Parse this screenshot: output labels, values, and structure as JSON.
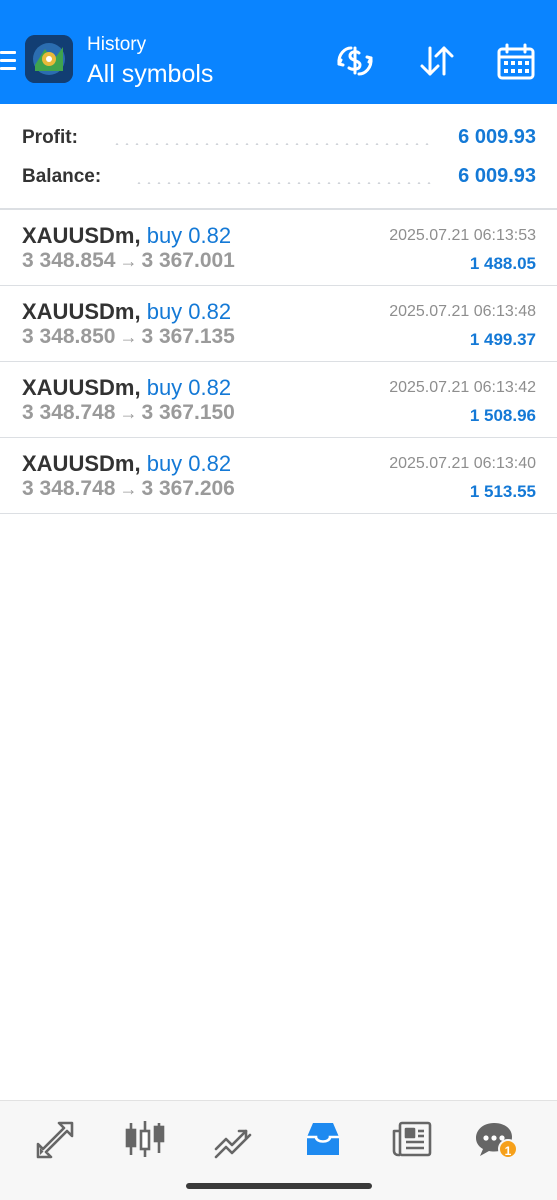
{
  "header": {
    "subtitle": "History",
    "title": "All symbols",
    "icons": [
      "menu-icon",
      "app-logo",
      "currency-filter-icon",
      "sort-icon",
      "calendar-icon"
    ],
    "accent_color": "#0a84ff"
  },
  "summary": {
    "profit_label": "Profit:",
    "profit_value": "6 009.93",
    "balance_label": "Balance:",
    "balance_value": "6 009.93"
  },
  "deals": [
    {
      "symbol": "XAUUSDm,",
      "type": "buy 0.82",
      "open_price": "3 348.854",
      "close_price": "3 367.001",
      "time": "2025.07.21 06:13:53",
      "profit": "1 488.05"
    },
    {
      "symbol": "XAUUSDm,",
      "type": "buy 0.82",
      "open_price": "3 348.850",
      "close_price": "3 367.135",
      "time": "2025.07.21 06:13:48",
      "profit": "1 499.37"
    },
    {
      "symbol": "XAUUSDm,",
      "type": "buy 0.82",
      "open_price": "3 348.748",
      "close_price": "3 367.150",
      "time": "2025.07.21 06:13:42",
      "profit": "1 508.96"
    },
    {
      "symbol": "XAUUSDm,",
      "type": "buy 0.82",
      "open_price": "3 348.748",
      "close_price": "3 367.206",
      "time": "2025.07.21 06:13:40",
      "profit": "1 513.55"
    }
  ],
  "arrow": "→",
  "bottom_nav": {
    "items": [
      "quotes-icon",
      "chart-icon",
      "trade-icon",
      "history-icon",
      "news-icon",
      "chat-icon"
    ],
    "active": "history-icon",
    "chat_badge": "1"
  },
  "colors": {
    "profit_blue": "#1479d6",
    "text_dark": "#333333",
    "text_grey": "#9a9a9a",
    "badge_orange": "#f6a01a"
  }
}
